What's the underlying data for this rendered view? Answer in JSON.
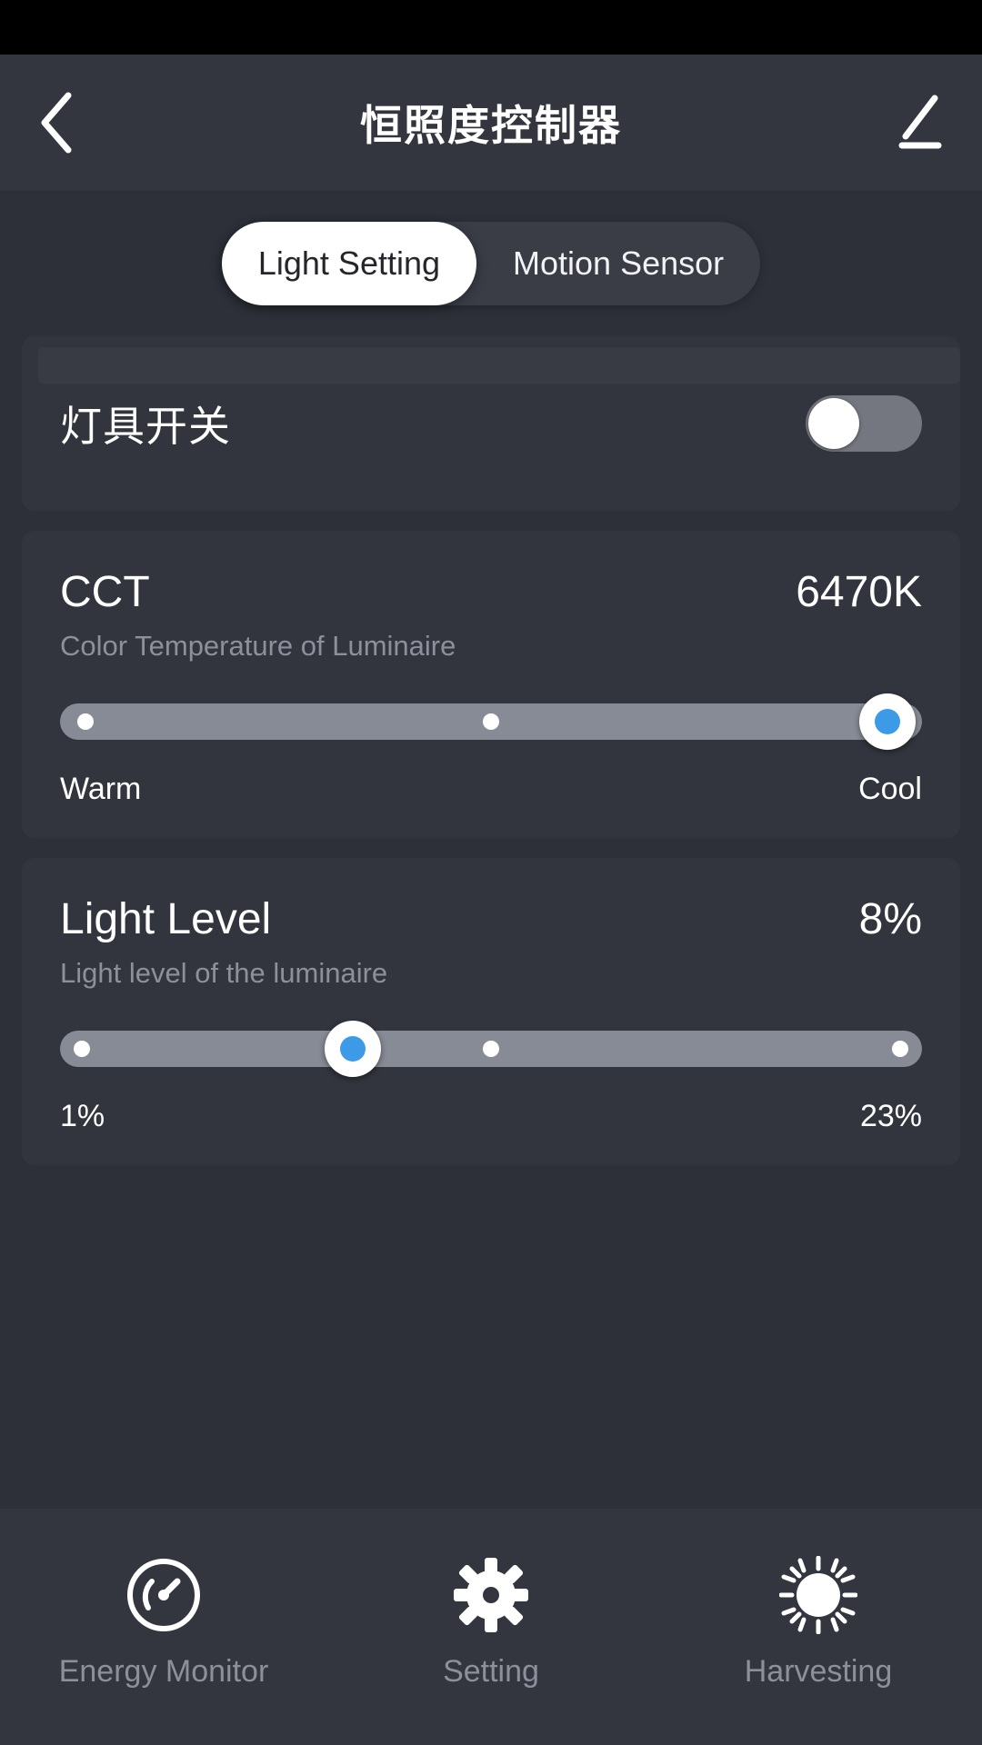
{
  "header": {
    "title": "恒照度控制器",
    "back_icon": "chevron-left-icon",
    "edit_icon": "pencil-edit-icon"
  },
  "tabs": [
    {
      "label": "Light Setting",
      "active": true
    },
    {
      "label": "Motion Sensor",
      "active": false
    }
  ],
  "power": {
    "label": "灯具开关",
    "state": "off"
  },
  "cct": {
    "title": "CCT",
    "value": "6470K",
    "subtitle": "Color Temperature of Luminaire",
    "min_label": "Warm",
    "max_label": "Cool",
    "thumb_percent": 96,
    "ticks": [
      1,
      50
    ]
  },
  "light_level": {
    "title": "Light Level",
    "value": "8%",
    "subtitle": "Light level of the luminaire",
    "min_label": "1%",
    "max_label": "23%",
    "thumb_percent": 34,
    "ticks": [
      1,
      50,
      99
    ]
  },
  "bottom_nav": [
    {
      "label": "Energy Monitor",
      "icon": "gauge-icon"
    },
    {
      "label": "Setting",
      "icon": "gear-icon"
    },
    {
      "label": "Harvesting",
      "icon": "sun-icon"
    }
  ],
  "colors": {
    "accent": "#3d9ae6",
    "background": "#2d3039",
    "card": "#32353e",
    "header": "#33363f",
    "track": "#878b95",
    "muted_text": "#8d909a"
  }
}
